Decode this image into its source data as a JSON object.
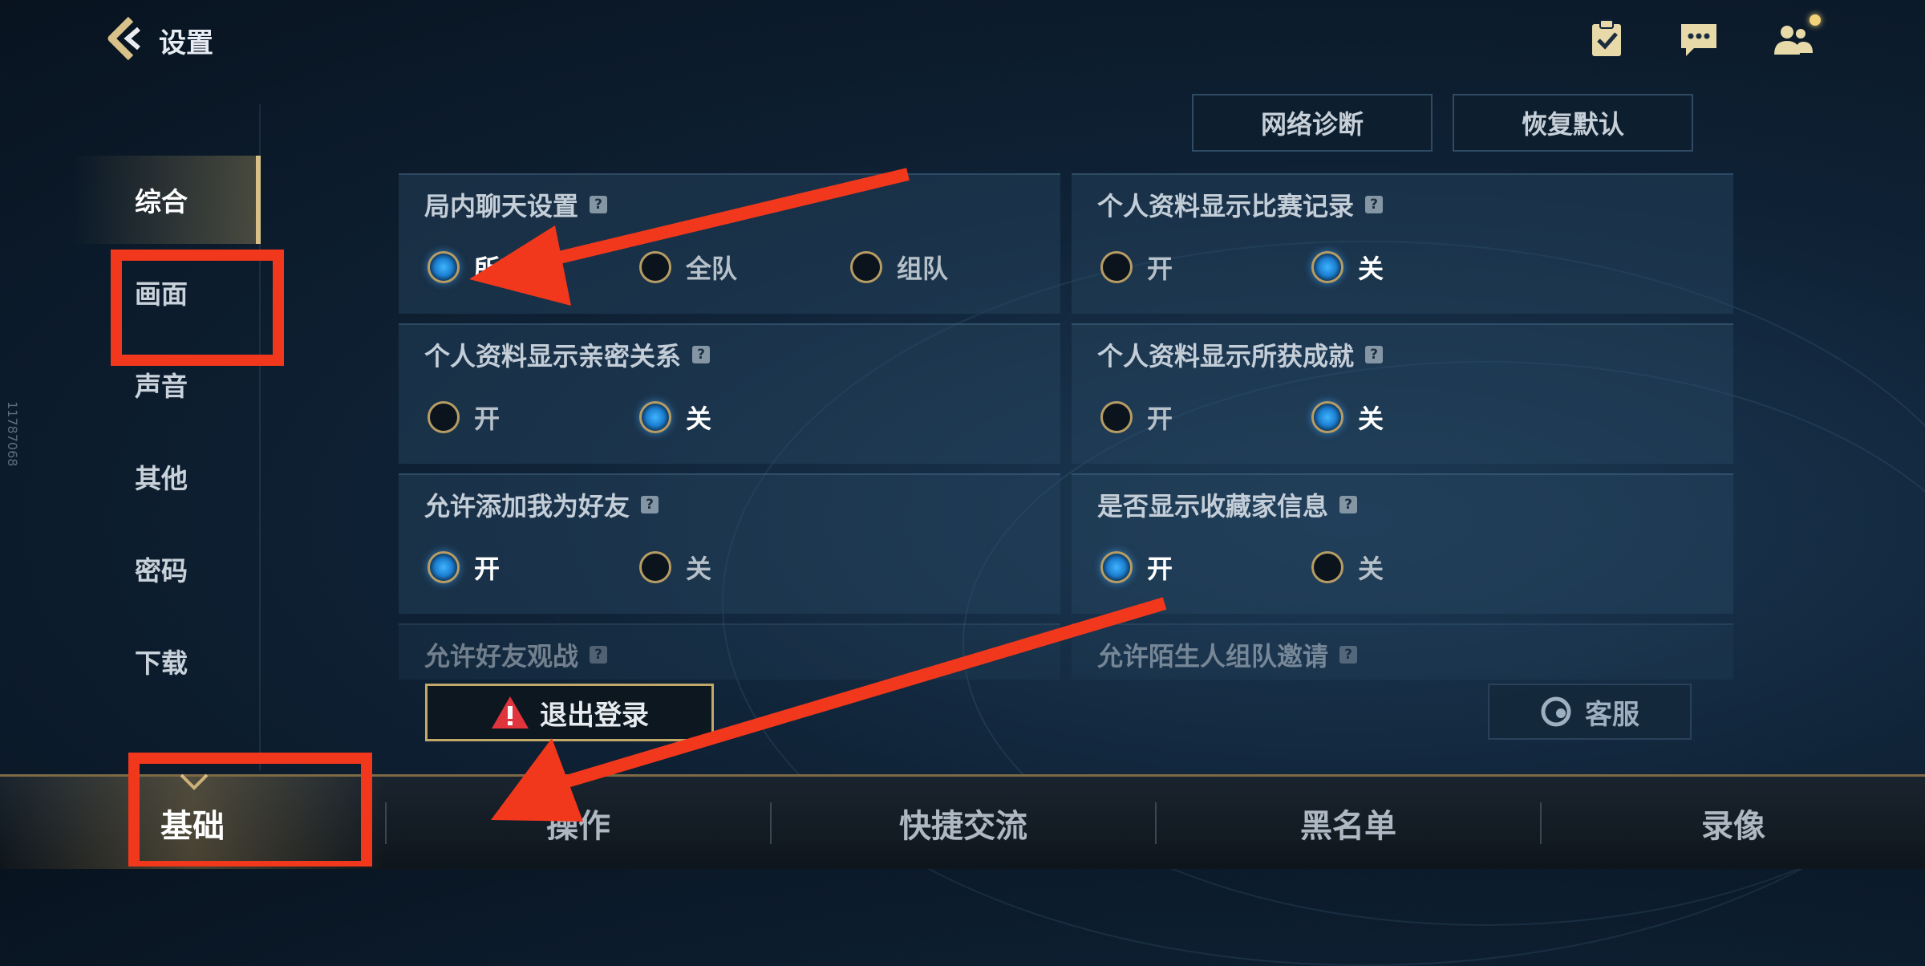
{
  "header": {
    "title": "设置",
    "icons": [
      "back-arrow-icon",
      "task-icon",
      "chat-icon",
      "friends-icon"
    ]
  },
  "toolbar": {
    "network_label": "网络诊断",
    "restore_label": "恢复默认"
  },
  "sidebar": {
    "items": [
      {
        "label": "综合",
        "active": true
      },
      {
        "label": "画面",
        "active": false
      },
      {
        "label": "声音",
        "active": false
      },
      {
        "label": "其他",
        "active": false
      },
      {
        "label": "密码",
        "active": false
      },
      {
        "label": "下载",
        "active": false
      }
    ]
  },
  "settings": [
    {
      "title": "局内聊天设置",
      "options": [
        "所有人",
        "全队",
        "组队"
      ],
      "selected": 0
    },
    {
      "title": "个人资料显示比赛记录",
      "options": [
        "开",
        "关"
      ],
      "selected": 1
    },
    {
      "title": "个人资料显示亲密关系",
      "options": [
        "开",
        "关"
      ],
      "selected": 1
    },
    {
      "title": "个人资料显示所获成就",
      "options": [
        "开",
        "关"
      ],
      "selected": 1
    },
    {
      "title": "允许添加我为好友",
      "options": [
        "开",
        "关"
      ],
      "selected": 0
    },
    {
      "title": "是否显示收藏家信息",
      "options": [
        "开",
        "关"
      ],
      "selected": 0
    },
    {
      "title": "允许好友观战",
      "options": [],
      "selected": null
    },
    {
      "title": "允许陌生人组队邀请",
      "options": [],
      "selected": null
    }
  ],
  "actions": {
    "logout_label": "退出登录",
    "service_label": "客服"
  },
  "bottom_tabs": [
    {
      "label": "基础",
      "active": true
    },
    {
      "label": "操作",
      "active": false
    },
    {
      "label": "快捷交流",
      "active": false
    },
    {
      "label": "黑名单",
      "active": false
    },
    {
      "label": "录像",
      "active": false
    }
  ],
  "watermark": "11787068",
  "colors": {
    "accent_gold": "#c2a96a",
    "radio_on": "#3fb4ff",
    "annotation_red": "#f2381c"
  }
}
